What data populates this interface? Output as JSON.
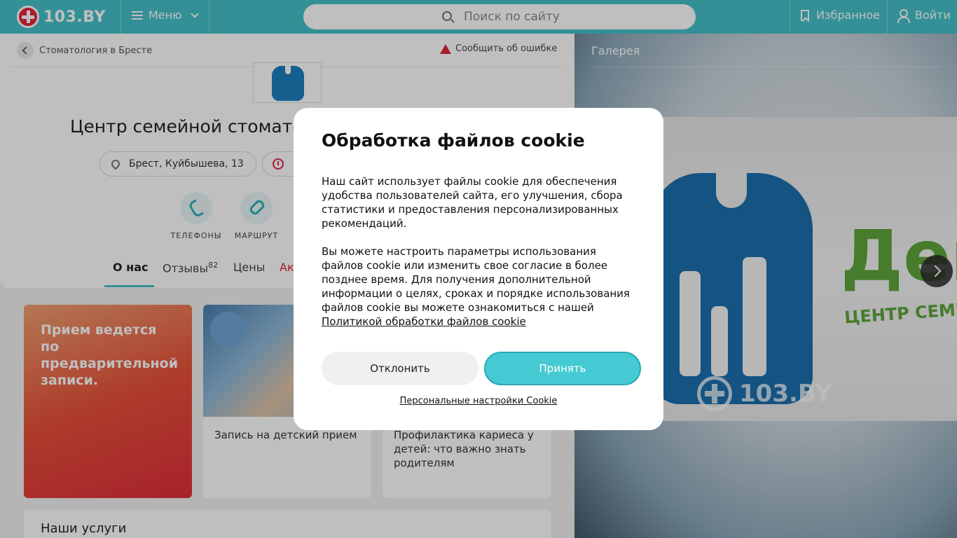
{
  "header": {
    "logo_text": "103.BY",
    "menu_label": "Меню",
    "search_placeholder": "Поиск по сайту",
    "favorites_label": "Избранное",
    "login_label": "Войти",
    "brand_color": "#45c1c8",
    "accent_color": "#e2243e"
  },
  "page": {
    "breadcrumb": "Стоматология в Бресте",
    "report_error": "Сообщить об ошибке",
    "clinic_title": "Центр семейной стоматологии",
    "address": "Брест, Куйбышева, 13",
    "actions": [
      {
        "label": "ТЕЛЕФОНЫ",
        "icon": "phone-icon"
      },
      {
        "label": "МАРШРУТ",
        "icon": "route-icon"
      }
    ],
    "tabs": [
      {
        "label": "О нас",
        "active": true
      },
      {
        "label": "Отзывы",
        "badge": "82"
      },
      {
        "label": "Цены"
      },
      {
        "label": "Акции"
      }
    ]
  },
  "cards": {
    "promo_text": "Прием ведется по предварительной записи.",
    "card1_caption": "Запись на детский прием",
    "card2_caption": "Профилактика кариеса у детей: что важно знать родителям"
  },
  "services_title": "Наши услуги",
  "gallery": {
    "title": "Галерея",
    "sign_text": "Ден",
    "sign_sub": "ЦЕНТР СЕМЕЙН",
    "watermark": "103.BY"
  },
  "cookie_modal": {
    "title": "Обработка файлов cookie",
    "paragraph1": "Наш сайт использует файлы cookie для обеспечения удобства пользователей сайта, его улучшения, сбора статистики и предоставления персонализированных рекомендаций.",
    "paragraph2": "Вы можете настроить параметры использования файлов cookie или изменить свое согласие в более позднее время. Для получения дополнительной информации о целях, сроках и порядке использования файлов cookie вы можете ознакомиться с нашей",
    "policy_link": "Политикой обработки файлов cookie",
    "decline_label": "Отклонить",
    "accept_label": "Принять",
    "settings_link": "Персональные настройки Cookie"
  }
}
